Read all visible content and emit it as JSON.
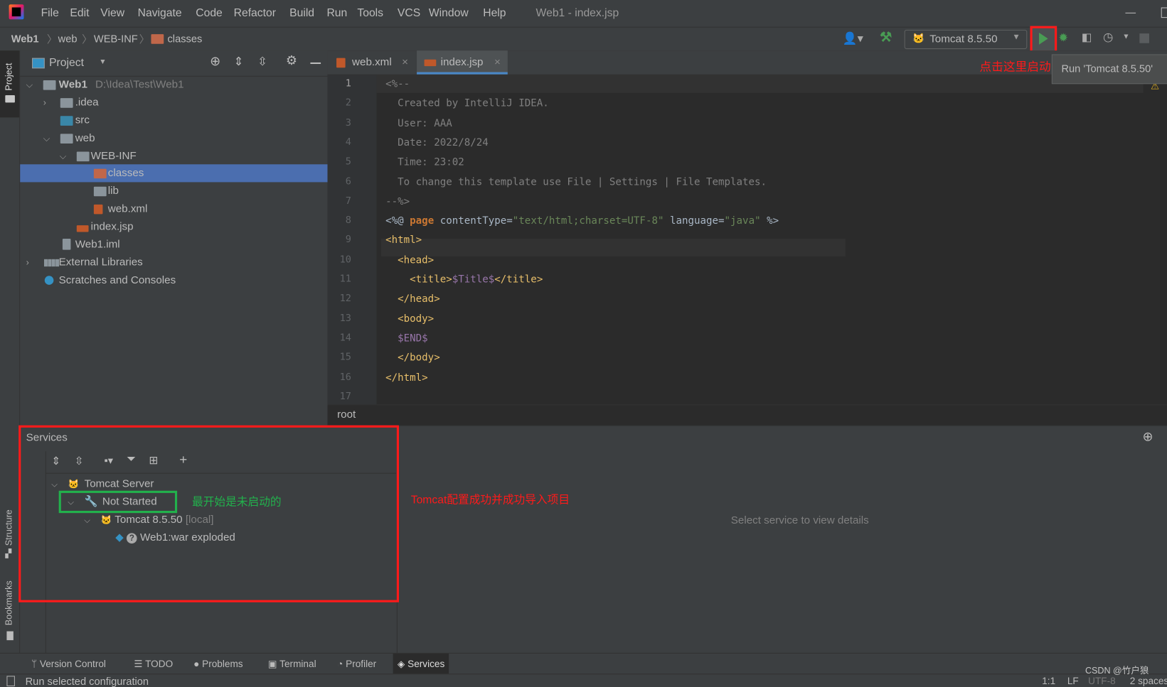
{
  "window": {
    "title": "Web1 - index.jsp"
  },
  "menu": [
    "File",
    "Edit",
    "View",
    "Navigate",
    "Code",
    "Refactor",
    "Build",
    "Run",
    "Tools",
    "VCS",
    "Window",
    "Help"
  ],
  "breadcrumb": [
    "Web1",
    "web",
    "WEB-INF",
    "classes"
  ],
  "toolbar": {
    "run_config": "Tomcat 8.5.50",
    "run_tooltip": "Run 'Tomcat 8.5.50'"
  },
  "side_stripe": {
    "project": "Project",
    "structure": "Structure",
    "bookmarks": "Bookmarks"
  },
  "project": {
    "title": "Project",
    "tree": [
      {
        "label": "Web1",
        "path": "D:\\Idea\\Test\\Web1"
      },
      {
        "label": ".idea"
      },
      {
        "label": "src"
      },
      {
        "label": "web"
      },
      {
        "label": "WEB-INF"
      },
      {
        "label": "classes"
      },
      {
        "label": "lib"
      },
      {
        "label": "web.xml"
      },
      {
        "label": "index.jsp"
      },
      {
        "label": "Web1.iml"
      },
      {
        "label": "External Libraries"
      },
      {
        "label": "Scratches and Consoles"
      }
    ]
  },
  "editor": {
    "tabs": [
      {
        "label": "web.xml"
      },
      {
        "label": "index.jsp",
        "active": true
      }
    ],
    "line_numbers": [
      "1",
      "2",
      "3",
      "4",
      "5",
      "6",
      "7",
      "8",
      "9",
      "10",
      "11",
      "12",
      "13",
      "14",
      "15",
      "16",
      "17"
    ],
    "lines": {
      "l1": "<%--",
      "l2": "  Created by IntelliJ IDEA.",
      "l3": "  User: AAA",
      "l4": "  Date: 2022/8/24",
      "l5": "  Time: 23:02",
      "l6": "  To change this template use File | Settings | File Templates.",
      "l7": "--%>",
      "l8a": "<%@ ",
      "l8b": "page",
      "l8c": " contentType=",
      "l8d": "\"text/html;charset=UTF-8\"",
      "l8e": " language=",
      "l8f": "\"java\"",
      "l8g": " %>",
      "l9": "<html>",
      "l10": "  <head>",
      "l11a": "    <title>",
      "l11b": "$Title$",
      "l11c": "</title>",
      "l12": "  </head>",
      "l13": "  <body>",
      "l14": "  $END$",
      "l15": "  </body>",
      "l16": "</html>"
    },
    "footer_breadcrumb": "root"
  },
  "services": {
    "title": "Services",
    "tree": [
      {
        "label": "Tomcat Server"
      },
      {
        "label": "Not Started"
      },
      {
        "label": "Tomcat 8.5.50",
        "suffix": "[local]"
      },
      {
        "label": "Web1:war exploded"
      }
    ],
    "details_placeholder": "Select service to view details"
  },
  "annotations": {
    "run_hint": "点击这里启动",
    "not_started_hint": "最开始是未启动的",
    "success_hint": "Tomcat配置成功并成功导入项目",
    "red": "#ff1a1a",
    "green": "#22b14c"
  },
  "tool_tabs": [
    "Version Control",
    "TODO",
    "Problems",
    "Terminal",
    "Profiler",
    "Services"
  ],
  "status": {
    "message": "Run selected configuration",
    "position": "1:1",
    "line_sep": "LF",
    "encoding": "UTF-8",
    "indent": "2 spaces",
    "watermark": "CSDN @竹户狼"
  }
}
